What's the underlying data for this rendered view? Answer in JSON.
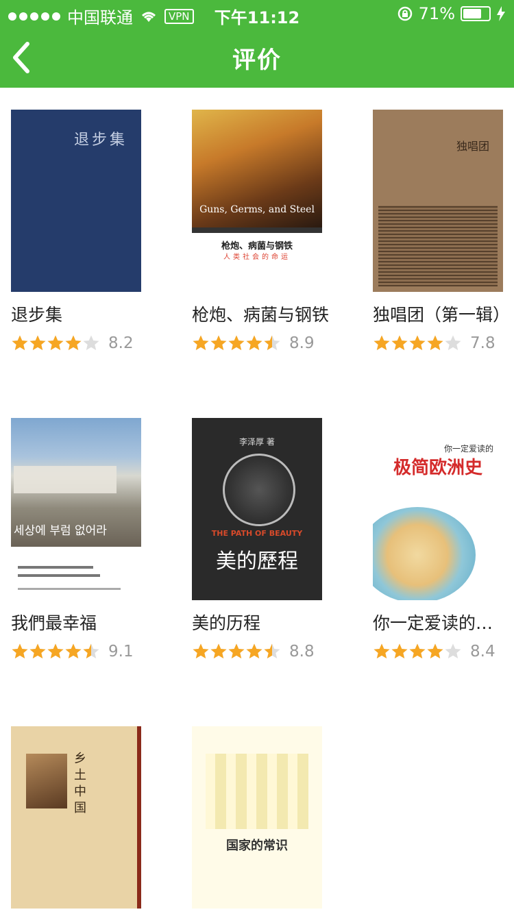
{
  "status": {
    "carrier": "中国联通",
    "vpn": "VPN",
    "time": "下午11:12",
    "battery_percent": "71%",
    "battery_level": 0.71
  },
  "nav": {
    "title": "评价",
    "back_icon": "chevron-left-icon"
  },
  "colors": {
    "accent": "#4bb93d",
    "star": "#f6a623",
    "star_empty": "#dddddd"
  },
  "books": [
    {
      "title": "退步集",
      "rating": 4,
      "score": "8.2",
      "cover_text": "退步集"
    },
    {
      "title": "枪炮、病菌与钢铁",
      "rating": 4.5,
      "score": "8.9",
      "cover_text": "Guns, Germs, and Steel",
      "cover_sub": "枪炮、病菌与钢铁",
      "cover_sub2": "人类社会的命运"
    },
    {
      "title": "独唱团（第一辑）",
      "rating": 4,
      "score": "7.8",
      "cover_text": "独唱团"
    },
    {
      "title": "我們最幸福",
      "rating": 4.5,
      "score": "9.1",
      "cover_text": "세상에 부럼 없어라"
    },
    {
      "title": "美的历程",
      "rating": 4.5,
      "score": "8.8",
      "cover_text": "美的歷程",
      "cover_sub": "THE PATH OF BEAUTY",
      "cover_author": "李泽厚 著"
    },
    {
      "title": "你一定爱读的极简欧洲史",
      "rating": 4,
      "score": "8.4",
      "cover_text": "极简欧洲史",
      "cover_sub": "你一定爱读的"
    },
    {
      "title": "乡土中国",
      "cover_text": "乡土中国"
    },
    {
      "title": "国家的常识",
      "cover_text": "国家的常识"
    }
  ]
}
